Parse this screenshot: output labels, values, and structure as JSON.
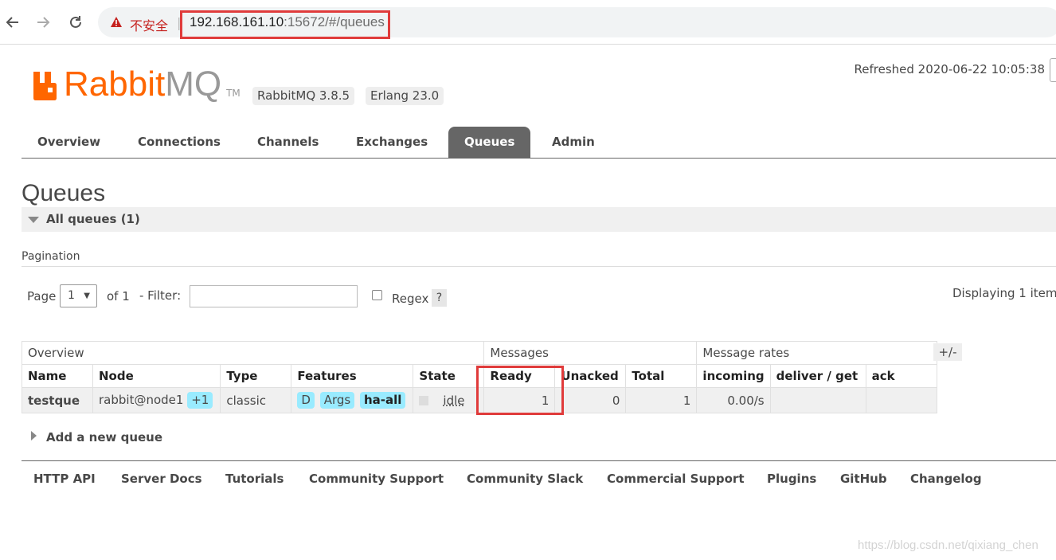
{
  "browser": {
    "security_label": "不安全",
    "separator": "|",
    "url_host": "192.168.161.10",
    "url_rest": ":15672/#/queues"
  },
  "header": {
    "logo_rabbit": "Rabbit",
    "logo_mq": "MQ",
    "logo_tm": "TM",
    "rabbitmq_version": "RabbitMQ 3.8.5",
    "erlang_version": "Erlang 23.0",
    "refreshed": "Refreshed 2020-06-22 10:05:38"
  },
  "tabs": [
    {
      "label": "Overview"
    },
    {
      "label": "Connections"
    },
    {
      "label": "Channels"
    },
    {
      "label": "Exchanges"
    },
    {
      "label": "Queues",
      "active": true
    },
    {
      "label": "Admin"
    }
  ],
  "page": {
    "title": "Queues",
    "section_label": "All queues (1)",
    "pagination_label": "Pagination"
  },
  "pagination": {
    "page_label": "Page",
    "page_value": "1",
    "of_label": "of 1",
    "filter_label": "- Filter:",
    "filter_value": "",
    "regex_label": "Regex",
    "help_label": "?",
    "displaying": "Displaying 1 item"
  },
  "table": {
    "groups": [
      "Overview",
      "Messages",
      "Message rates"
    ],
    "columns": [
      "Name",
      "Node",
      "Type",
      "Features",
      "State",
      "Ready",
      "Unacked",
      "Total",
      "incoming",
      "deliver / get",
      "ack"
    ],
    "toggle_label": "+/-",
    "rows": [
      {
        "name": "testque",
        "node": "rabbit@node1",
        "node_badge": "+1",
        "type": "classic",
        "features": [
          "D",
          "Args",
          "ha-all"
        ],
        "state": "idle",
        "ready": "1",
        "unacked": "0",
        "total": "1",
        "incoming": "0.00/s",
        "deliver_get": "",
        "ack": ""
      }
    ]
  },
  "add_queue_label": "Add a new queue",
  "footer": [
    "HTTP API",
    "Server Docs",
    "Tutorials",
    "Community Support",
    "Community Slack",
    "Commercial Support",
    "Plugins",
    "GitHub",
    "Changelog"
  ],
  "watermark": "https://blog.csdn.net/qixiang_chen",
  "colors": {
    "brand_orange": "#ff6600",
    "feature_pill": "#99ebff",
    "tab_active": "#666666",
    "highlight_red": "#e03b3b"
  }
}
